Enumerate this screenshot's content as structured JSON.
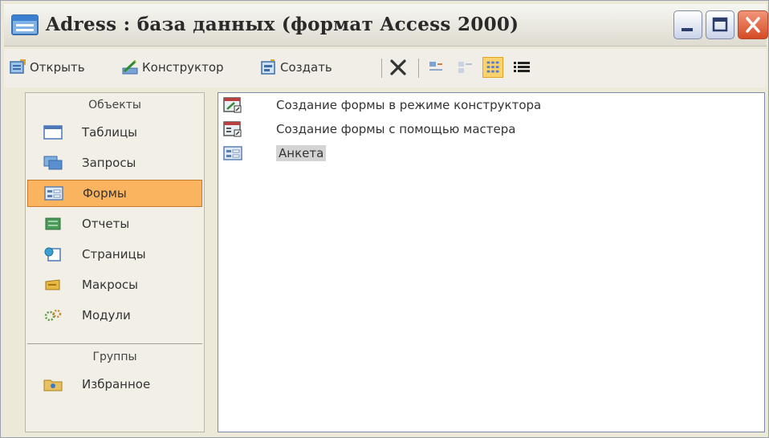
{
  "window": {
    "title": "Adress : база данных (формат Access 2000)",
    "icons": {
      "title": "database-window-icon",
      "minimize": "minimize-icon",
      "maximize": "maximize-icon",
      "close": "close-icon"
    },
    "colors": {
      "selection": "#fab460",
      "close_button": "#d54b24"
    }
  },
  "toolbar": {
    "open_label": "Открыть",
    "design_label": "Конструктор",
    "create_label": "Создать",
    "icons": [
      "open-icon",
      "design-icon",
      "create-icon",
      "delete-icon",
      "large-icons-icon",
      "small-icons-icon",
      "list-view-icon",
      "details-view-icon"
    ]
  },
  "objects_pane": {
    "objects_header": "Объекты",
    "items": [
      {
        "label": "Таблицы",
        "icon": "table-icon",
        "selected": false
      },
      {
        "label": "Запросы",
        "icon": "query-icon",
        "selected": false
      },
      {
        "label": "Формы",
        "icon": "form-icon",
        "selected": true
      },
      {
        "label": "Отчеты",
        "icon": "report-icon",
        "selected": false
      },
      {
        "label": "Страницы",
        "icon": "page-icon",
        "selected": false
      },
      {
        "label": "Макросы",
        "icon": "macro-icon",
        "selected": false
      },
      {
        "label": "Модули",
        "icon": "module-icon",
        "selected": false
      }
    ],
    "groups_header": "Группы",
    "groups": [
      {
        "label": "Избранное",
        "icon": "favorites-folder-icon"
      }
    ]
  },
  "forms_list": [
    {
      "label": "Создание формы в режиме конструктора",
      "icon": "design-form-shortcut-icon",
      "selected": false
    },
    {
      "label": "Создание формы с помощью мастера",
      "icon": "wizard-form-shortcut-icon",
      "selected": false
    },
    {
      "label": "Анкета",
      "icon": "form-icon",
      "selected": true
    }
  ]
}
